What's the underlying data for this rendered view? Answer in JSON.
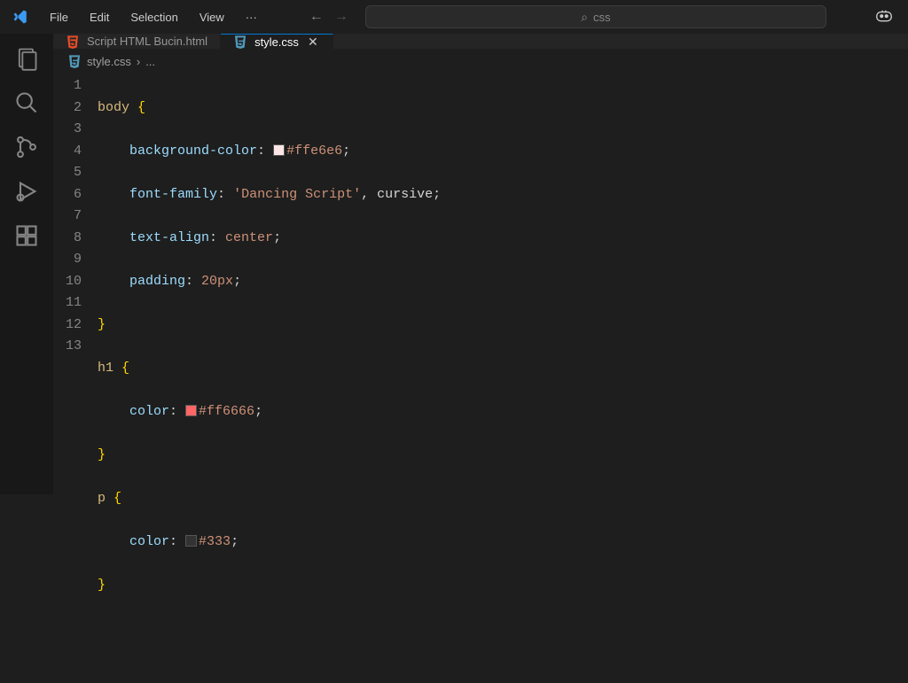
{
  "menu": {
    "file": "File",
    "edit": "Edit",
    "selection": "Selection",
    "view": "View",
    "overflow": "···"
  },
  "search": {
    "icon": "⌕",
    "placeholder": "css"
  },
  "tabs": {
    "tab0_label": "Script HTML Bucin.html",
    "tab1_label": "style.css",
    "close_glyph": "✕"
  },
  "breadcrumb": {
    "file": "style.css",
    "chevron": "›",
    "more": "..."
  },
  "lines": {
    "l1": "1",
    "l2": "2",
    "l3": "3",
    "l4": "4",
    "l5": "5",
    "l6": "6",
    "l7": "7",
    "l8": "8",
    "l9": "9",
    "l10": "10",
    "l11": "11",
    "l12": "12",
    "l13": "13"
  },
  "code": {
    "body_sel": "body",
    "h1_sel": "h1",
    "p_sel": "p",
    "open_brace": " {",
    "close_brace": "}",
    "indent": "    ",
    "prop_bg": "background-color",
    "prop_ff": "font-family",
    "prop_ta": "text-align",
    "prop_pad": "padding",
    "prop_color": "color",
    "colon": ": ",
    "semi": ";",
    "val_bgcolor": "#ffe6e6",
    "val_ff_str": "'Dancing Script'",
    "val_ff_sep": ", ",
    "val_ff_id": "cursive",
    "val_ta": "center",
    "val_pad": "20px",
    "val_h1col": "#ff6666",
    "val_pcol": "#333"
  },
  "swatches": {
    "body_bg": "#ffe6e6",
    "h1_col": "#ff6666",
    "p_col": "#333333"
  }
}
